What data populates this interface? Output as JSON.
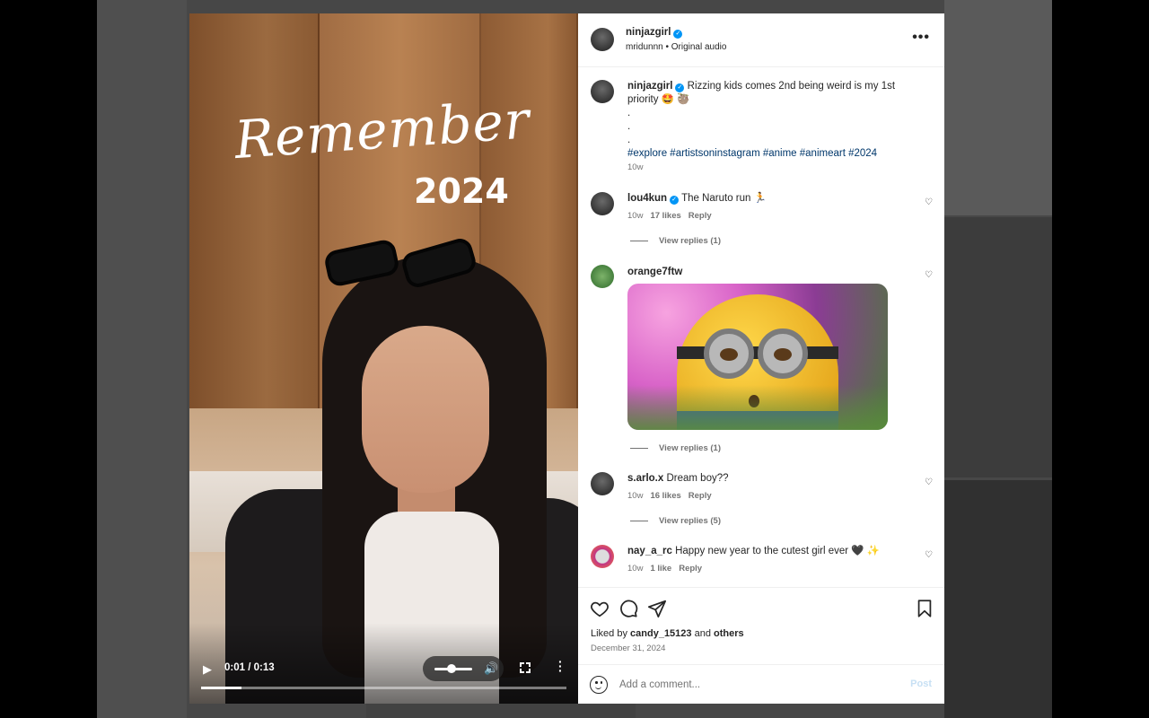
{
  "post": {
    "username": "ninjazgirl",
    "audio": "mridunnn • Original audio",
    "more": "•••"
  },
  "video": {
    "title": "Remember",
    "year": "2024",
    "time": "0:01 / 0:13",
    "progress": 0.11,
    "volume": 0.45
  },
  "caption": {
    "username": "ninjazgirl",
    "text": " Rizzing kids comes 2nd being weird is my 1st priority 🤩 🦥",
    "dots": [
      ".",
      ".",
      "."
    ],
    "hashtags": "#explore #artistsoninstagram #anime #animeart #2024",
    "time": "10w"
  },
  "comments": [
    {
      "username": "lou4kun",
      "text": " The Naruto run 🏃",
      "time": "10w",
      "likes": "17 likes",
      "reply": "Reply",
      "view_replies": "View replies (1)"
    },
    {
      "username": "orange7ftw",
      "text": "",
      "view_replies": "View replies (1)"
    },
    {
      "username": "s.arlo.x",
      "text": " Dream boy??",
      "time": "10w",
      "likes": "16 likes",
      "reply": "Reply",
      "view_replies": "View replies (5)"
    },
    {
      "username": "nay_a_rc",
      "text": " Happy new year to the cutest girl ever 🖤 ✨",
      "time": "10w",
      "likes": "1 like",
      "reply": "Reply"
    }
  ],
  "actions": {
    "liked_by_prefix": "Liked by ",
    "liked_by_user": "candy_15123",
    "liked_by_mid": " and ",
    "liked_by_others": "others",
    "date": "December 31, 2024"
  },
  "comment_box": {
    "placeholder": "Add a comment...",
    "post_label": "Post"
  },
  "colors": {
    "verified": "#0095f6",
    "hashtag": "#00376b",
    "muted": "#737373",
    "post_disabled": "#c7e0f4"
  }
}
